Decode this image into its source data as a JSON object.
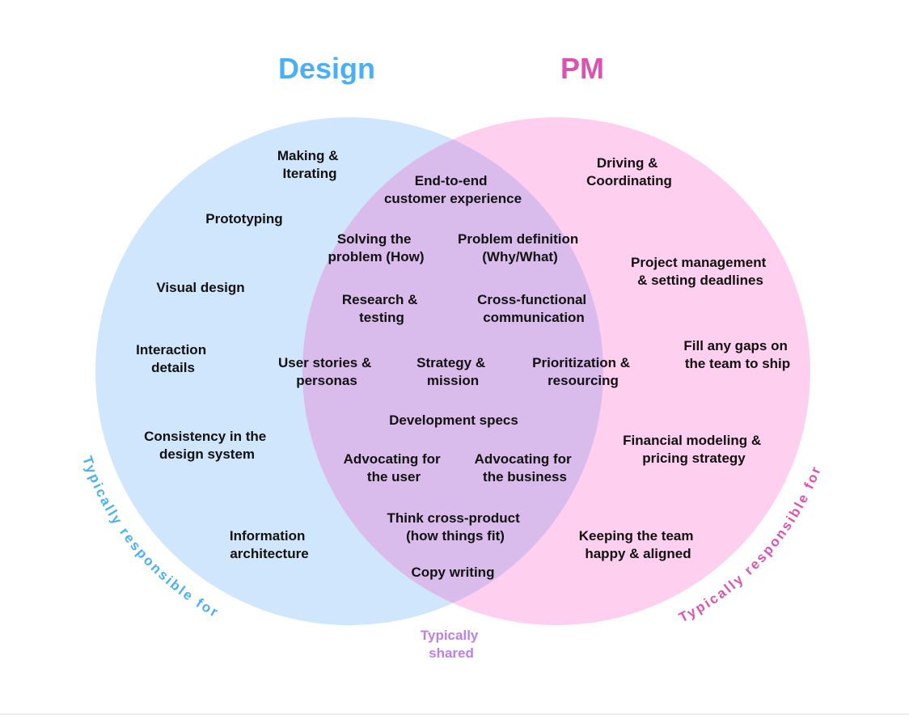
{
  "titles": {
    "design": "Design",
    "pm": "PM"
  },
  "colors": {
    "design_circle": "#D0E6FC",
    "pm_circle": "#FECFEE",
    "overlap": "#DABCEC",
    "design_accent": "#4AAFF3",
    "pm_accent": "#DC52B0",
    "shared_accent": "#BC80E6",
    "label_text": "#111111"
  },
  "design_only": [
    [
      "Making &",
      "Iterating"
    ],
    [
      "Prototyping"
    ],
    [
      "Visual design"
    ],
    [
      "Interaction",
      "details"
    ],
    [
      "Consistency in the",
      "design system"
    ],
    [
      "Information",
      "architecture"
    ]
  ],
  "shared": [
    [
      "End-to-end",
      "customer experience"
    ],
    [
      "Solving the",
      "problem (How)"
    ],
    [
      "Problem definition",
      "(Why/What)"
    ],
    [
      "Research &",
      "testing"
    ],
    [
      "Cross-functional",
      "communication"
    ],
    [
      "User stories &",
      "personas"
    ],
    [
      "Strategy &",
      "mission"
    ],
    [
      "Prioritization &",
      "resourcing"
    ],
    [
      "Development specs"
    ],
    [
      "Advocating for",
      "the user"
    ],
    [
      "Advocating for",
      "the business"
    ],
    [
      "Think cross-product",
      "(how things fit)"
    ],
    [
      "Copy writing"
    ]
  ],
  "pm_only": [
    [
      "Driving &",
      "Coordinating"
    ],
    [
      "Project management",
      "& setting deadlines"
    ],
    [
      "Fill any gaps on",
      "the team to ship"
    ],
    [
      "Financial modeling &",
      "pricing strategy"
    ],
    [
      "Keeping the team",
      "happy & aligned"
    ]
  ],
  "captions": {
    "design_arc": "Typically responsible for",
    "pm_arc": "Typically responsible for",
    "shared": [
      "Typically",
      "shared"
    ]
  }
}
